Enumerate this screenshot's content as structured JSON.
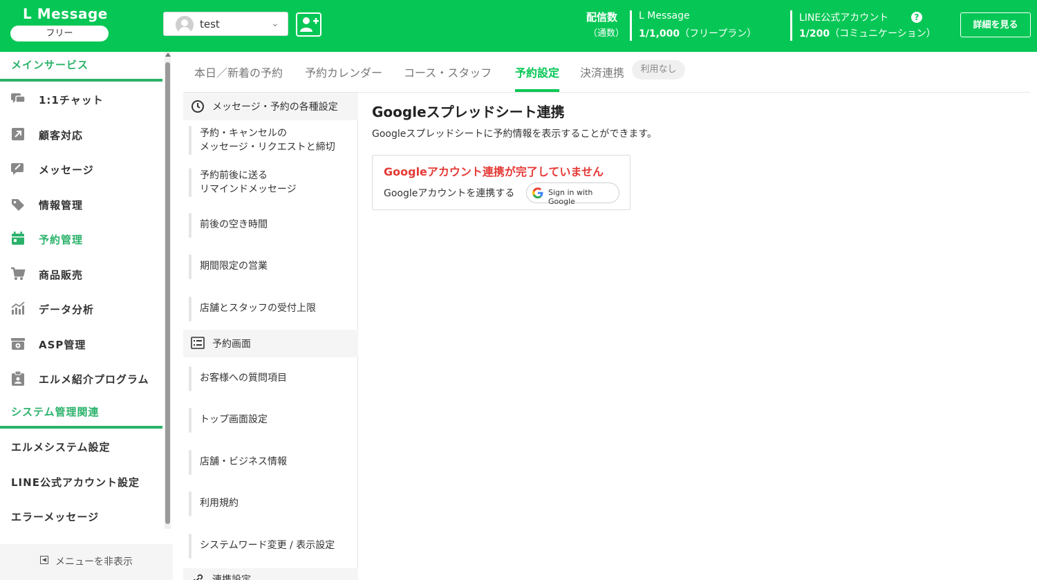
{
  "header": {
    "logo_title": "L Message",
    "plan_badge": "フリー",
    "account_name": "test",
    "stat_label": "配信数",
    "stat_sub": "（通数）",
    "lmessage_name": "L Message",
    "lmessage_value": "1/1,000",
    "lmessage_plan": "（フリープラン）",
    "line_name": "LINE公式アカウント",
    "line_value": "1/200",
    "line_plan": "（コミュニケーション）",
    "help": "?",
    "detail_button": "詳細を見る"
  },
  "sidebar": {
    "main_section": "メインサービス",
    "items": [
      {
        "label": "1:1チャット",
        "icon": "chat-icon"
      },
      {
        "label": "顧客対応",
        "icon": "arrow-icon"
      },
      {
        "label": "メッセージ",
        "icon": "message-edit-icon"
      },
      {
        "label": "情報管理",
        "icon": "tag-icon"
      },
      {
        "label": "予約管理",
        "icon": "calendar-icon",
        "active": true
      },
      {
        "label": "商品販売",
        "icon": "cart-icon"
      },
      {
        "label": "データ分析",
        "icon": "chart-icon"
      },
      {
        "label": "ASP管理",
        "icon": "asp-icon"
      },
      {
        "label": "エルメ紹介プログラム",
        "icon": "clipboard-icon"
      }
    ],
    "system_section": "システム管理関連",
    "system_items": [
      "エルメシステム設定",
      "LINE公式アカウント設定",
      "エラーメッセージ"
    ],
    "hide_menu": "メニューを非表示"
  },
  "tabs": [
    {
      "label": "本日／新着の予約"
    },
    {
      "label": "予約カレンダー"
    },
    {
      "label": "コース・スタッフ"
    },
    {
      "label": "予約設定",
      "active": true
    },
    {
      "label": "決済連携"
    }
  ],
  "tab_badge": "利用なし",
  "submenu": {
    "group1": "メッセージ・予約の各種設定",
    "group1_items": [
      "予約・キャンセルの\nメッセージ・リクエストと締切",
      "予約前後に送る\nリマインドメッセージ",
      "前後の空き時間",
      "期間限定の営業",
      "店舗とスタッフの受付上限"
    ],
    "group2": "予約画面",
    "group2_items": [
      "お客様への質問項目",
      "トップ画面設定",
      "店舗・ビジネス情報",
      "利用規約",
      "システムワード変更 / 表示設定"
    ],
    "group3": "連携設定"
  },
  "main": {
    "title": "Googleスプレッドシート連携",
    "description": "Googleスプレッドシートに予約情報を表示することができます。",
    "alert": "Googleアカウント連携が完了していません",
    "link_text": "Googleアカウントを連携する",
    "google_button": "Sign in with Google"
  },
  "colors": {
    "brand": "#06c755",
    "sidebar_accent": "#2bb26a",
    "alert": "#e53935"
  }
}
